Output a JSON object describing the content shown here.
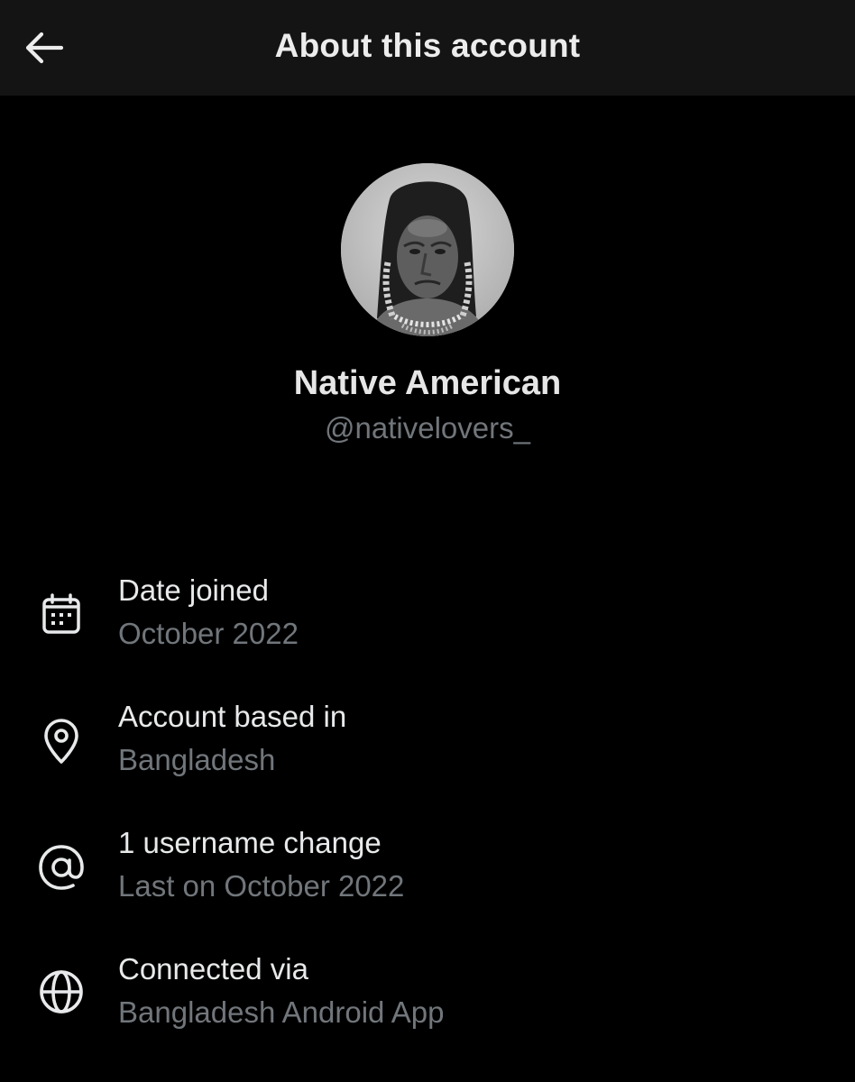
{
  "header": {
    "title": "About this account",
    "back_icon": "arrow-left-icon"
  },
  "profile": {
    "display_name": "Native American",
    "handle": "@nativelovers_"
  },
  "details": [
    {
      "icon": "calendar-icon",
      "label": "Date joined",
      "value": "October 2022"
    },
    {
      "icon": "location-pin-icon",
      "label": "Account based in",
      "value": "Bangladesh"
    },
    {
      "icon": "at-sign-icon",
      "label": "1 username change",
      "value": "Last on October 2022"
    },
    {
      "icon": "globe-icon",
      "label": "Connected via",
      "value": "Bangladesh Android App"
    }
  ],
  "colors": {
    "background": "#000000",
    "header_background": "#141414",
    "primary_text": "#e7e9ea",
    "secondary_text": "#71767b"
  }
}
